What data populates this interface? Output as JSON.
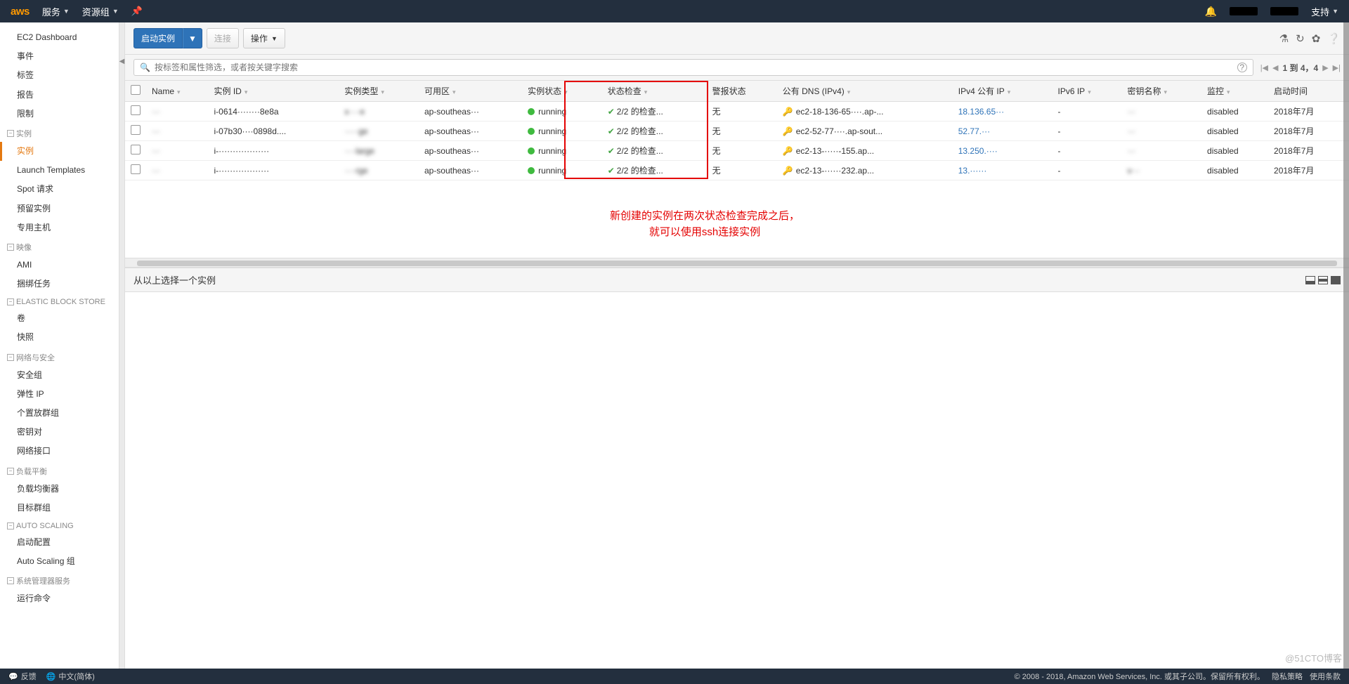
{
  "topnav": {
    "logo": "aws",
    "services": "服务",
    "resource_groups": "资源组",
    "support": "支持"
  },
  "sidebar": {
    "top": [
      "EC2 Dashboard",
      "事件",
      "标签",
      "报告",
      "限制"
    ],
    "groups": [
      {
        "title": "实例",
        "items": [
          "实例",
          "Launch Templates",
          "Spot 请求",
          "预留实例",
          "专用主机"
        ],
        "active_index": 0
      },
      {
        "title": "映像",
        "items": [
          "AMI",
          "捆绑任务"
        ]
      },
      {
        "title": "ELASTIC BLOCK STORE",
        "items": [
          "卷",
          "快照"
        ]
      },
      {
        "title": "网络与安全",
        "items": [
          "安全组",
          "弹性 IP",
          "个置放群组",
          "密钥对",
          "网络接口"
        ]
      },
      {
        "title": "负载平衡",
        "items": [
          "负载均衡器",
          "目标群组"
        ]
      },
      {
        "title": "AUTO SCALING",
        "items": [
          "启动配置",
          "Auto Scaling 组"
        ]
      },
      {
        "title": "系统管理器服务",
        "items": [
          "运行命令"
        ]
      }
    ]
  },
  "toolbar": {
    "launch": "启动实例",
    "connect": "连接",
    "actions": "操作"
  },
  "search": {
    "placeholder": "按标签和属性筛选，或者按关键字搜索",
    "pager_text": "1 到 4，4"
  },
  "table": {
    "headers": [
      "",
      "Name",
      "实例 ID",
      "实例类型",
      "可用区",
      "实例状态",
      "状态检查",
      "警报状态",
      "公有 DNS (IPv4)",
      "IPv4 公有 IP",
      "IPv6 IP",
      "密钥名称",
      "监控",
      "启动时间"
    ],
    "rows": [
      {
        "name": "···",
        "id": "i-0614········8e8a",
        "type": "x····e",
        "az": "ap-southeas···",
        "state": "running",
        "check": "2/2 的检查...",
        "alarm": "无",
        "dns": "ec2-18-136-65····.ap-...",
        "ip": "18.136.65···",
        "ipv6": "-",
        "keyname": "···",
        "monitor": "disabled",
        "launch": "2018年7月"
      },
      {
        "name": "···",
        "id": "i-07b30····0898d....",
        "type": "·····ge",
        "az": "ap-southeas···",
        "state": "running",
        "check": "2/2 的检查...",
        "alarm": "无",
        "dns": "ec2-52-77····.ap-sout...",
        "ip": "52.77.···",
        "ipv6": "-",
        "keyname": "···",
        "monitor": "disabled",
        "launch": "2018年7月"
      },
      {
        "name": "···",
        "id": "i-··················",
        "type": "····large",
        "az": "ap-southeas···",
        "state": "running",
        "check": "2/2 的检查...",
        "alarm": "无",
        "dns": "ec2-13-·····-155.ap...",
        "ip": "13.250.····",
        "ipv6": "-",
        "keyname": "···",
        "monitor": "disabled",
        "launch": "2018年7月"
      },
      {
        "name": "···",
        "id": "i-··················",
        "type": "····rge",
        "az": "ap-southeas···",
        "state": "running",
        "check": "2/2 的检查...",
        "alarm": "无",
        "dns": "ec2-13-······232.ap...",
        "ip": "13.······",
        "ipv6": "-",
        "keyname": "v···",
        "monitor": "disabled",
        "launch": "2018年7月"
      }
    ]
  },
  "annotation": {
    "line1": "新创建的实例在两次状态检查完成之后，",
    "line2": "就可以使用ssh连接实例"
  },
  "detail": {
    "title": "从以上选择一个实例"
  },
  "footer": {
    "feedback": "反馈",
    "language": "中文(简体)",
    "copyright": "© 2008 - 2018, Amazon Web Services, Inc. 或其子公司。保留所有权利。",
    "privacy": "隐私策略",
    "terms": "使用条款"
  },
  "watermark": "@51CTO博客"
}
